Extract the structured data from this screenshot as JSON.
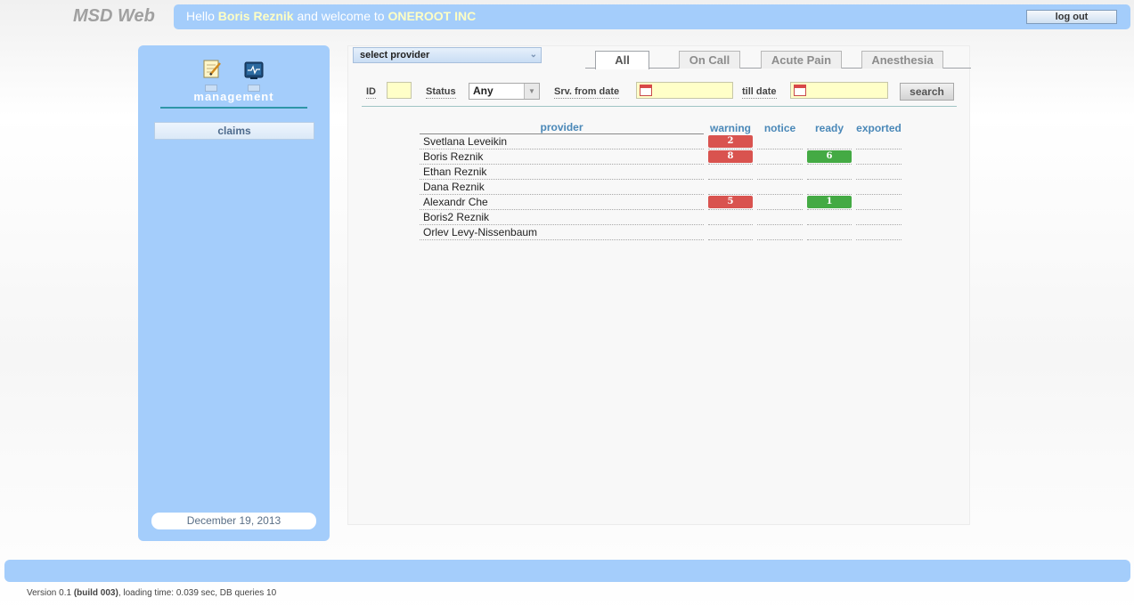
{
  "header": {
    "app_title": "MSD Web",
    "hello": "Hello ",
    "user": "Boris Reznik",
    "welcome_to": " and welcome to ",
    "org": "ONEROOT INC",
    "logout_label": "log out"
  },
  "sidebar": {
    "section_label": "management",
    "claims_label": "claims",
    "date": "December 19, 2013",
    "icons": [
      "notes-edit-icon",
      "monitor-icon"
    ]
  },
  "filters": {
    "provider_select": "select provider",
    "tabs": [
      "All",
      "On Call",
      "Acute Pain",
      "Anesthesia"
    ],
    "active_tab": "All",
    "id_label": "ID",
    "id_value": "",
    "status_label": "Status",
    "status_value": "Any",
    "from_label": "Srv. from date",
    "from_value": "",
    "till_label": "till date",
    "till_value": "",
    "search_label": "search"
  },
  "table": {
    "columns": [
      "provider",
      "warning",
      "notice",
      "ready",
      "exported"
    ],
    "rows": [
      {
        "provider": "Svetlana Leveikin",
        "warning": "2",
        "notice": "",
        "ready": "",
        "exported": ""
      },
      {
        "provider": "Boris Reznik",
        "warning": "8",
        "notice": "",
        "ready": "6",
        "exported": ""
      },
      {
        "provider": "Ethan Reznik",
        "warning": "",
        "notice": "",
        "ready": "",
        "exported": ""
      },
      {
        "provider": "Dana Reznik",
        "warning": "",
        "notice": "",
        "ready": "",
        "exported": ""
      },
      {
        "provider": "Alexandr Che",
        "warning": "5",
        "notice": "",
        "ready": "1",
        "exported": ""
      },
      {
        "provider": "Boris2 Reznik",
        "warning": "",
        "notice": "",
        "ready": "",
        "exported": ""
      },
      {
        "provider": "Orlev Levy-Nissenbaum",
        "warning": "",
        "notice": "",
        "ready": "",
        "exported": ""
      }
    ]
  },
  "footer": {
    "version": "Version 0.1 ",
    "build": "(build 003)",
    "stats": ", loading time: 0.039 sec, DB queries 10"
  },
  "colors": {
    "header_blue": "#a4cdfb",
    "warning_red": "#d9534f",
    "ready_green": "#44aa44",
    "input_yellow": "#ffffc8"
  }
}
